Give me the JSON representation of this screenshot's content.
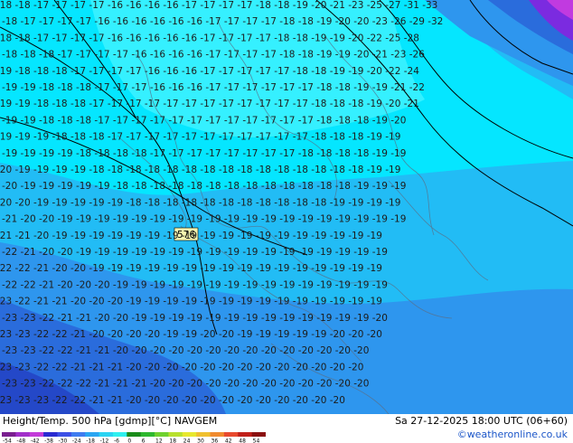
{
  "map": {
    "region_label": "576",
    "label_rows": [
      "-18 -18 -17 -17 -17 -17 -16 -16 -16 -16 -17 -17 -17 -17 -18 -18 -19 -20 -21 -23 -25 -27 -31 -33",
      "-18 -17 -17 -17 -17 -16 -16 -16 -16 -16 -16 -17 -17 -17 -17 -18 -18 -19 -20 -20 -23 -26 -29 -32",
      "-18 -18 -17 -17 -17 -17 -16 -16 -16 -16 -16 -17 -17 -17 -17 -18 -18 -19 -19 -20 -22 -25 -28",
      "-18 -18 -18 -17 -17 -17 -17 -16 -16 -16 -16 -17 -17 -17 -17 -18 -18 -19 -19 -20 -21 -23 -26",
      "-19 -18 -18 -18 -17 -17 -17 -17 -16 -16 -16 -17 -17 -17 -17 -17 -18 -18 -19 -19 -20 -22 -24",
      "-19 -19 -18 -18 -18 -17 -17 -17 -16 -16 -16 -17 -17 -17 -17 -17 -17 -18 -18 -19 -19 -21 -22",
      "-19 -19 -18 -18 -18 -17 -17 -17 -17 -17 -17 -17 -17 -17 -17 -17 -17 -18 -18 -18 -19 -20 -21",
      "-19 -19 -18 -18 -18 -17 -17 -17 -17 -17 -17 -17 -17 -17 -17 -17 -17 -18 -18 -18 -19 -20",
      "-19 -19 -19 -18 -18 -18 -17 -17 -17 -17 -17 -17 -17 -17 -17 -17 -17 -18 -18 -18 -19 -19",
      "-19 -19 -19 -19 -18 -18 -18 -18 -17 -17 -17 -17 -17 -17 -17 -17 -18 -18 -18 -18 -19 -19",
      "-20 -19 -19 -19 -19 -18 -18 -18 -18 -18 -18 -18 -18 -18 -18 -18 -18 -18 -18 -18 -19 -19",
      "-20 -19 -19 -19 -19 -19 -18 -18 -18 -18 -18 -18 -18 -18 -18 -18 -18 -18 -18 -19 -19 -19",
      "-20 -20 -19 -19 -19 -19 -19 -18 -18 -18 -18 -18 -18 -18 -18 -18 -18 -18 -19 -19 -19 -19",
      "-21 -20 -20 -19 -19 -19 -19 -19 -19 -19 -19 -19 -19 -19 -19 -19 -19 -19 -19 -19 -19 -19",
      "-21 -21 -20 -19 -19 -19 -19 -19 -19 -19 -19 -19 -19 -19 -19 -19 -19 -19 -19 -19 -19",
      "-22 -21 -20 -20 -19 -19 -19 -19 -19 -19 -19 -19 -19 -19 -19 -19 -19 -19 -19 -19 -19",
      "-22 -22 -21 -20 -20 -19 -19 -19 -19 -19 -19 -19 -19 -19 -19 -19 -19 -19 -19 -19 -19",
      "-22 -22 -21 -20 -20 -20 -19 -19 -19 -19 -19 -19 -19 -19 -19 -19 -19 -19 -19 -19 -19",
      "-23 -22 -21 -21 -20 -20 -20 -19 -19 -19 -19 -19 -19 -19 -19 -19 -19 -19 -19 -19 -19",
      "-23 -23 -22 -21 -21 -20 -20 -19 -19 -19 -19 -19 -19 -19 -19 -19 -19 -19 -19 -19 -20",
      "-23 -23 -22 -22 -21 -20 -20 -20 -20 -19 -19 -20 -20 -19 -19 -19 -19 -19 -20 -20 -20",
      "-23 -23 -22 -22 -21 -21 -20 -20 -20 -20 -20 -20 -20 -20 -20 -20 -20 -20 -20 -20",
      "-23 -23 -22 -22 -21 -21 -21 -20 -20 -20 -20 -20 -20 -20 -20 -20 -20 -20 -20 -20",
      "-23 -23 -22 -22 -22 -21 -21 -21 -20 -20 -20 -20 -20 -20 -20 -20 -20 -20 -20 -20",
      "-23 -23 -23 -22 -22 -21 -21 -20 -20 -20 -20 -20 -20 -20 -20 -20 -20 -20 -20"
    ]
  },
  "footer": {
    "title": "Height/Temp. 500 hPa [gdmp][°C] NAVGEM",
    "valid": "Sa 27-12-2025 18:00 UTC (06+60)",
    "credit": "©weatheronline.co.uk",
    "scale_labels": [
      "-54",
      "-48",
      "-42",
      "-38",
      "-30",
      "-24",
      "-18",
      "-12",
      "-6",
      "0",
      "6",
      "12",
      "18",
      "24",
      "30",
      "36",
      "42",
      "48",
      "54"
    ],
    "scale_colors": [
      "#7a1f8f",
      "#a12fc9",
      "#c33bd9",
      "#2a2ad1",
      "#3c4fe6",
      "#3f7cf0",
      "#2aa5f2",
      "#2ad3f2",
      "#2ef0f0",
      "#1a8c1a",
      "#2eb82e",
      "#6fd12e",
      "#b8e02e",
      "#e8e82e",
      "#f0c02e",
      "#f08a2e",
      "#e84a2e",
      "#c0201a",
      "#8a1010"
    ]
  },
  "colors": {
    "cyan": "#05e6ff",
    "light_cyan": "#35f0ff",
    "sky": "#22bcf5",
    "blue": "#2e96ee",
    "deep_blue": "#2a6cdc",
    "navy": "#2448c8",
    "purple": "#7b2be0",
    "violet": "#c13ae0",
    "label_gray": "#1c1c1c",
    "contour_black": "#000000"
  }
}
